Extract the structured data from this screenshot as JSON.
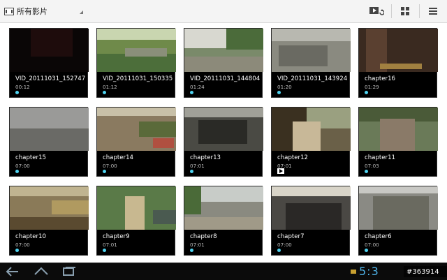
{
  "topbar": {
    "filter_label": "所有影片",
    "slideshow_icon": "slideshow-icon",
    "grid_view_icon": "grid-view-icon",
    "menu_icon": "menu-icon"
  },
  "videos": [
    {
      "title": "VID_20111031_152747",
      "duration": "00:12",
      "thumb": "dark-night-scene",
      "marker": "dot"
    },
    {
      "title": "VID_20111031_150335",
      "duration": "01:12",
      "thumb": "zoo-enclosure-fence",
      "marker": "dot"
    },
    {
      "title": "VID_20111031_144804",
      "duration": "01:24",
      "thumb": "zoo-animals-building",
      "marker": "dot"
    },
    {
      "title": "VID_20111031_143924",
      "duration": "01:20",
      "thumb": "zoo-rocks-animals",
      "marker": "dot"
    },
    {
      "title": "chapter16",
      "duration": "01:29",
      "thumb": "interior-hall-subtitles",
      "marker": "dot"
    },
    {
      "title": "chapter15",
      "duration": "07:00",
      "thumb": "crowd-protest",
      "marker": "dot"
    },
    {
      "title": "chapter14",
      "duration": "07:00",
      "thumb": "village-rooftops",
      "marker": "dot"
    },
    {
      "title": "chapter13",
      "duration": "07:01",
      "thumb": "construction-pit",
      "marker": "dot"
    },
    {
      "title": "chapter12",
      "duration": "07:01",
      "thumb": "family-group",
      "marker": "play"
    },
    {
      "title": "chapter11",
      "duration": "07:03",
      "thumb": "villagers-standing",
      "marker": "dot"
    },
    {
      "title": "chapter10",
      "duration": "07:00",
      "thumb": "market-street",
      "marker": "dot"
    },
    {
      "title": "chapter9",
      "duration": "07:01",
      "thumb": "man-in-garden",
      "marker": "dot"
    },
    {
      "title": "chapter8",
      "duration": "07:01",
      "thumb": "town-square",
      "marker": "dot"
    },
    {
      "title": "chapter7",
      "duration": "07:00",
      "thumb": "meeting-hall",
      "marker": "dot"
    },
    {
      "title": "chapter6",
      "duration": "07:00",
      "thumb": "scaffold-building",
      "marker": "dot"
    }
  ],
  "statusbar": {
    "back_icon": "back-icon",
    "home_icon": "home-icon",
    "recent_apps_icon": "recent-apps-icon",
    "clock": "5:3",
    "watermark": "#363914"
  },
  "colors": {
    "accent": "#4fd3f0",
    "clock": "#4fb3e8"
  }
}
